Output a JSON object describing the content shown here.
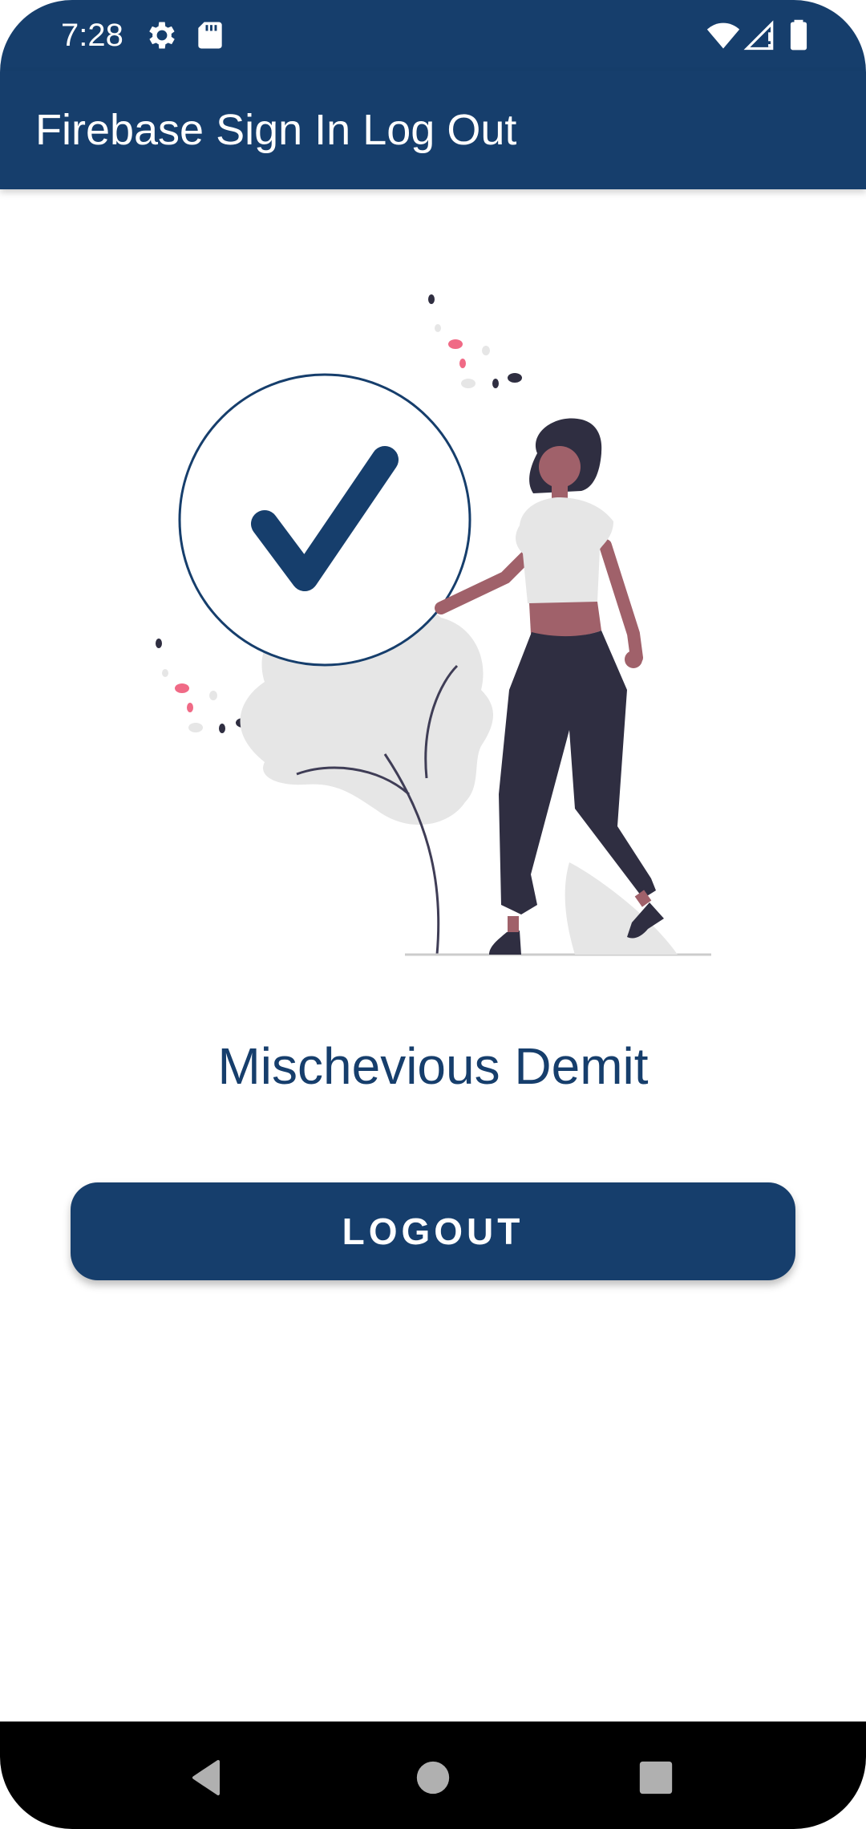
{
  "status_bar": {
    "time": "7:28",
    "icons": [
      "settings-gear-icon",
      "sd-card-icon",
      "wifi-icon",
      "cell-signal-icon",
      "battery-icon"
    ]
  },
  "app_bar": {
    "title": "Firebase Sign In Log Out"
  },
  "illustration": {
    "description_icon": "success-checkmark-illustration"
  },
  "user": {
    "display_name": "Mischevious Demit"
  },
  "logout_button": {
    "label": "LOGOUT"
  },
  "nav_bar": {
    "icons": [
      "back-icon",
      "home-icon",
      "recents-icon"
    ]
  },
  "colors": {
    "primary": "#163e6c",
    "accent_pink": "#f06a86",
    "figure_dark": "#2f2e41",
    "skin": "#a0616a",
    "light_gray": "#e6e6e6",
    "background": "#ffffff"
  }
}
